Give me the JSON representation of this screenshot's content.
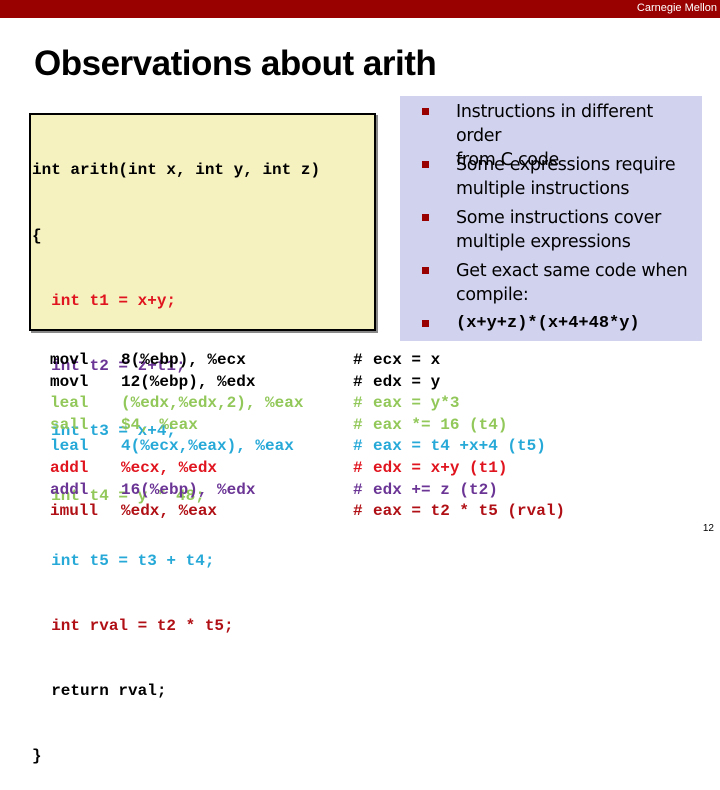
{
  "header": {
    "brand": "Carnegie Mellon",
    "bar_color": "#990000"
  },
  "slide": {
    "title": "Observations about arith",
    "page_number": "12"
  },
  "colors": {
    "black": "#000000",
    "red": "#e0141e",
    "purple": "#6b3595",
    "cyan": "#27a9d8",
    "green": "#92c85a",
    "darkred": "#b01015"
  },
  "c_code": {
    "lines": [
      {
        "text": "int arith(int x, int y, int z)",
        "color": "black"
      },
      {
        "text": "{",
        "color": "black"
      },
      {
        "text": "  int t1 = x+y;",
        "color": "red"
      },
      {
        "text": "  int t2 = z+t1;",
        "color": "purple"
      },
      {
        "text": "  int t3 = x+4;",
        "color": "cyan"
      },
      {
        "text": "  int t4 = y * 48;",
        "color": "green"
      },
      {
        "text": "  int t5 = t3 + t4;",
        "color": "cyan"
      },
      {
        "text": "  int rval = t2 * t5;",
        "color": "darkred"
      },
      {
        "text": "  return rval;",
        "color": "black"
      },
      {
        "text": "}",
        "color": "black"
      }
    ]
  },
  "bullets": [
    {
      "text": "Instructions in different order from C code",
      "lines": [
        "Instructions in different order",
        "from C code"
      ]
    },
    {
      "text": "Some expressions require multiple instructions",
      "lines": [
        "Some expressions require",
        "multiple instructions"
      ]
    },
    {
      "text": "Some instructions cover multiple expressions",
      "lines": [
        "Some instructions cover",
        "multiple expressions"
      ]
    },
    {
      "text": "Get exact same code when compile:",
      "lines": [
        "Get exact same code when",
        "compile:"
      ]
    },
    {
      "text": "(x+y+z)*(x+4+48*y)",
      "lines": [
        "(x+y+z)*(x+4+48*y)"
      ],
      "code": true
    }
  ],
  "assembly": [
    {
      "op": "movl",
      "args": "8(%ebp), %ecx",
      "hash": "#",
      "comment": "ecx = x",
      "color": "black"
    },
    {
      "op": "movl",
      "args": "12(%ebp), %edx",
      "hash": "#",
      "comment": "edx = y",
      "color": "black"
    },
    {
      "op": "leal",
      "args": "(%edx,%edx,2), %eax",
      "hash": "#",
      "comment": "eax = y*3",
      "color": "green"
    },
    {
      "op": "sall",
      "args": "$4, %eax",
      "hash": "#",
      "comment": "eax *= 16 (t4)",
      "color": "green"
    },
    {
      "op": "leal",
      "args": "4(%ecx,%eax), %eax",
      "hash": "#",
      "comment": "eax = t4 +x+4 (t5)",
      "color": "cyan"
    },
    {
      "op": "addl",
      "args": "%ecx, %edx",
      "hash": "#",
      "comment": "edx = x+y (t1)",
      "color": "red"
    },
    {
      "op": "addl",
      "args": "16(%ebp), %edx",
      "hash": "#",
      "comment": "edx += z (t2)",
      "color": "purple"
    },
    {
      "op": "imull",
      "args": "%edx, %eax",
      "hash": "#",
      "comment": "eax = t2 * t5 (rval)",
      "color": "darkred"
    }
  ]
}
